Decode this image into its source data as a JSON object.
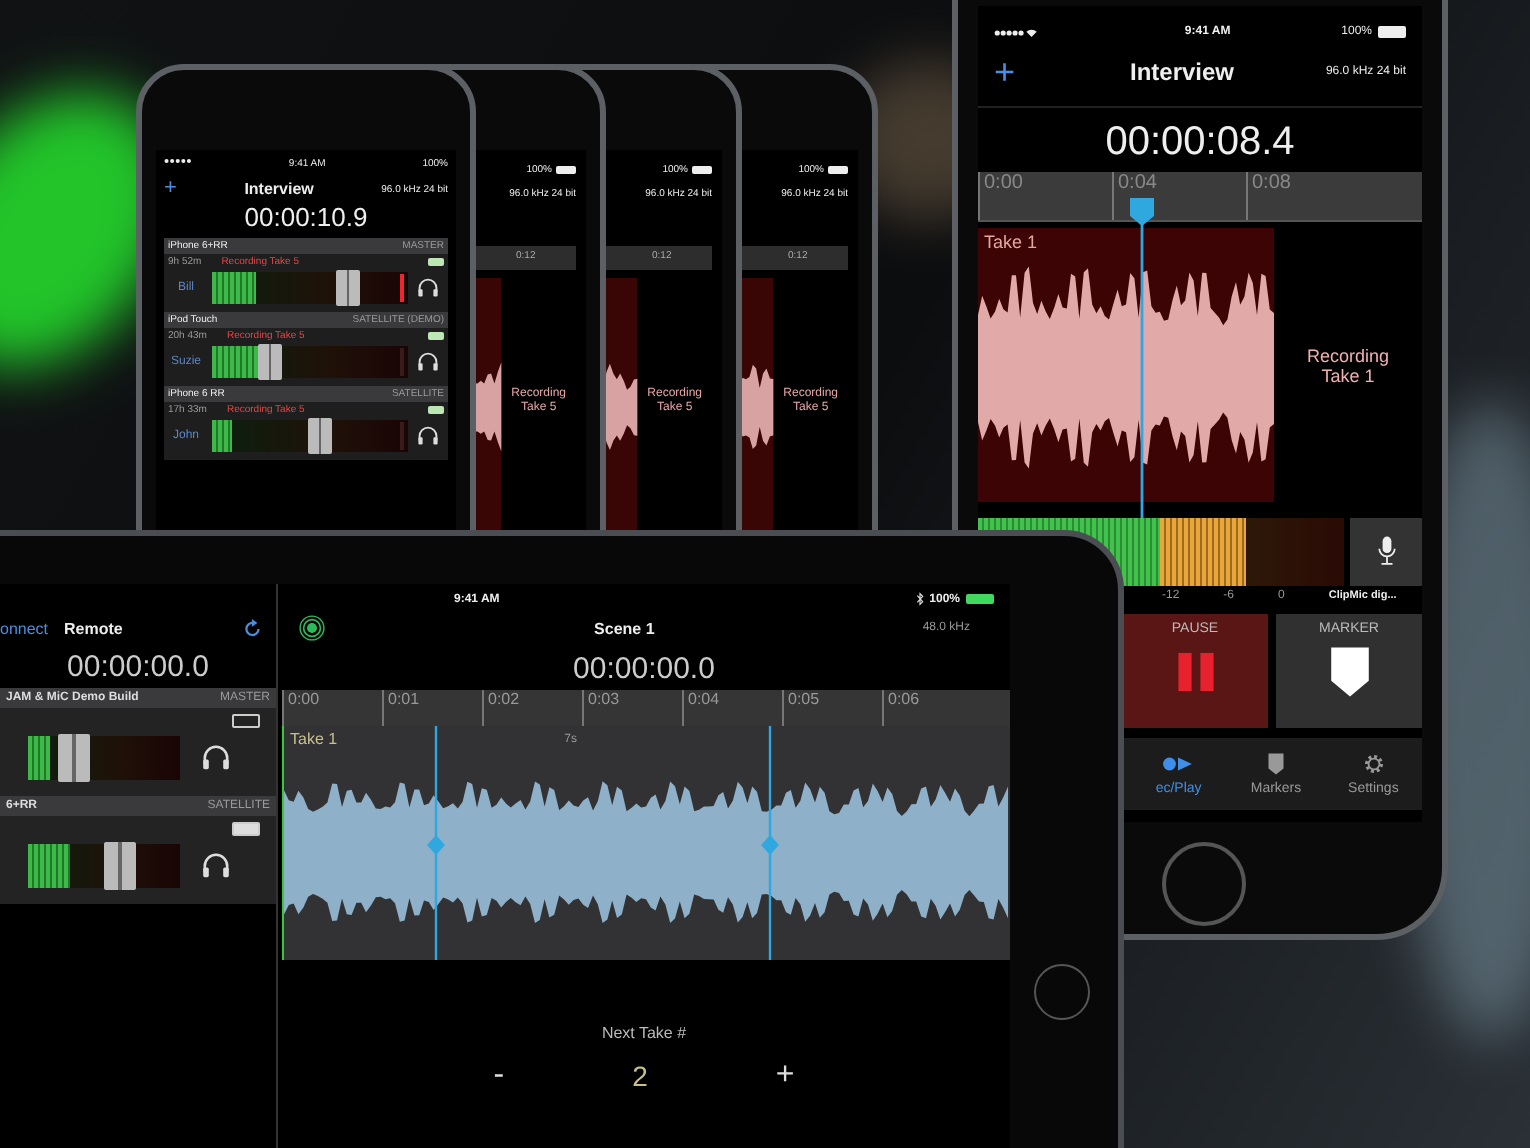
{
  "back_phones": [
    {
      "battery": "100%",
      "format": "96.0 kHz 24 bit",
      "ruler_tick": "0:12",
      "recording_status": "Recording Take 5"
    },
    {
      "battery": "100%",
      "format": "96.0 kHz 24 bit",
      "ruler_tick": "0:12",
      "recording_status": "Recording Take 5"
    },
    {
      "battery": "100%",
      "format": "96.0 kHz 24 bit",
      "ruler_tick": "0:12",
      "recording_status": "Recording Take 5"
    }
  ],
  "group_phone": {
    "time": "9:41 AM",
    "battery": "100%",
    "add": "+",
    "title": "Interview",
    "format": "96.0 kHz 24 bit",
    "timecode": "00:00:10.9",
    "devices": [
      {
        "name": "iPhone 6+RR",
        "role": "MASTER",
        "remaining": "9h 52m",
        "status": "Recording Take 5",
        "user": "Bill",
        "meter": {
          "level": 0.22
        },
        "fader": {
          "level": 0.69
        },
        "clipping": true
      },
      {
        "name": "iPod Touch",
        "role": "SATELLITE (DEMO)",
        "remaining": "20h 43m",
        "status": "Recording Take 5",
        "user": "Suzie",
        "meter": {
          "level": 0.25
        },
        "fader": {
          "level": 0.3
        },
        "clipping": false
      },
      {
        "name": "iPhone 6 RR",
        "role": "SATELLITE",
        "remaining": "17h 33m",
        "status": "Recording Take 5",
        "user": "John",
        "meter": {
          "level": 0.1
        },
        "fader": {
          "level": 0.55
        },
        "clipping": false
      }
    ]
  },
  "main_phone": {
    "time": "9:41 AM",
    "battery": "100%",
    "add": "+",
    "title": "Interview",
    "format": "96.0 kHz 24 bit",
    "timecode": "00:00:08.4",
    "ruler_ticks": [
      "0:00",
      "0:04",
      "0:08"
    ],
    "take": "Take 1",
    "recording_status": "Recording Take 1",
    "meter": {
      "level": 0.73
    },
    "meter_scale": [
      "-12",
      "-6",
      "0"
    ],
    "input": "ClipMic dig...",
    "buttons": [
      {
        "label": "PAUSE",
        "kind": "pause"
      },
      {
        "label": "MARKER",
        "kind": "marker"
      }
    ],
    "tabs": [
      {
        "label": "ec/Play",
        "kind": "recplay",
        "selected": true
      },
      {
        "label": "Markers",
        "kind": "markers",
        "selected": false
      },
      {
        "label": "Settings",
        "kind": "settings",
        "selected": false
      }
    ]
  },
  "tablet": {
    "connect": "onnect",
    "remote": "Remote",
    "time": "9:41 AM",
    "title": "Scene 1",
    "format": "48.0 kHz",
    "battery": "100%",
    "left_timecode": "00:00:00.0",
    "timecode": "00:00:00.0",
    "devices": [
      {
        "name": "JAM & MiC Demo Build",
        "role": "MASTER",
        "meter": {
          "level": 0.14
        },
        "fader": {
          "level": 0.3
        }
      },
      {
        "name": "6+RR",
        "role": "SATELLITE",
        "meter": {
          "level": 0.28
        },
        "fader": {
          "level": 0.6
        }
      }
    ],
    "ruler_ticks": [
      "0:00",
      "0:01",
      "0:02",
      "0:03",
      "0:04",
      "0:05",
      "0:06"
    ],
    "take": "Take 1",
    "duration": "7s",
    "next_take_label": "Next Take #",
    "minus": "-",
    "next_take": "2",
    "plus": "+"
  }
}
